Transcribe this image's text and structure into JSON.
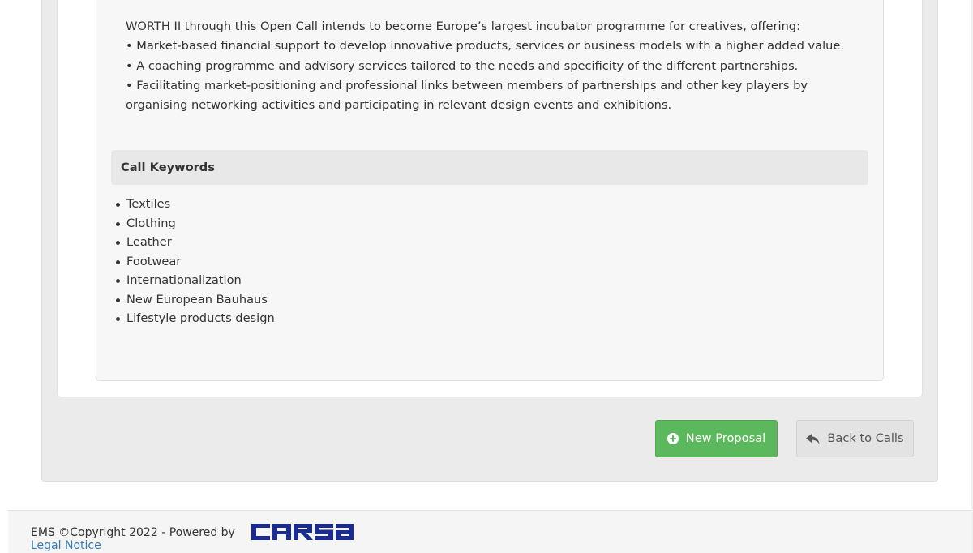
{
  "description": {
    "lines": [
      "WORTH II through this Open Call intends to become Europe’s largest incubator programme for creatives, offering:",
      "• Market-based financial support to develop innovative products, services or business models with a higher added value.",
      "• A coaching programme and advisory services tailored to the needs and specificity of the different partnerships.",
      "• Facilitating market-positioning and professional links between members of partnerships and other key players by",
      "organising networking activities and participating in relevant design events and exhibitions."
    ]
  },
  "keywords": {
    "title": "Call Keywords",
    "items": [
      "Textiles",
      "Clothing",
      "Leather",
      "Footwear",
      "Internationalization",
      "New European Bauhaus",
      "Lifestyle products design"
    ]
  },
  "actions": {
    "new_proposal_label": "New Proposal",
    "new_proposal_icon": "plus-circle-icon",
    "back_label": "Back to Calls",
    "back_icon": "reply-arrow-icon"
  },
  "footer": {
    "copyright": "EMS ©Copyright 2022 - Powered by",
    "logo_text": "CARSA",
    "legal_notice": "Legal Notice"
  },
  "colors": {
    "primary_button": "#5cb85c",
    "default_button": "#e3e3e3",
    "logo": "#1a2c8f",
    "link": "#337ab7"
  }
}
